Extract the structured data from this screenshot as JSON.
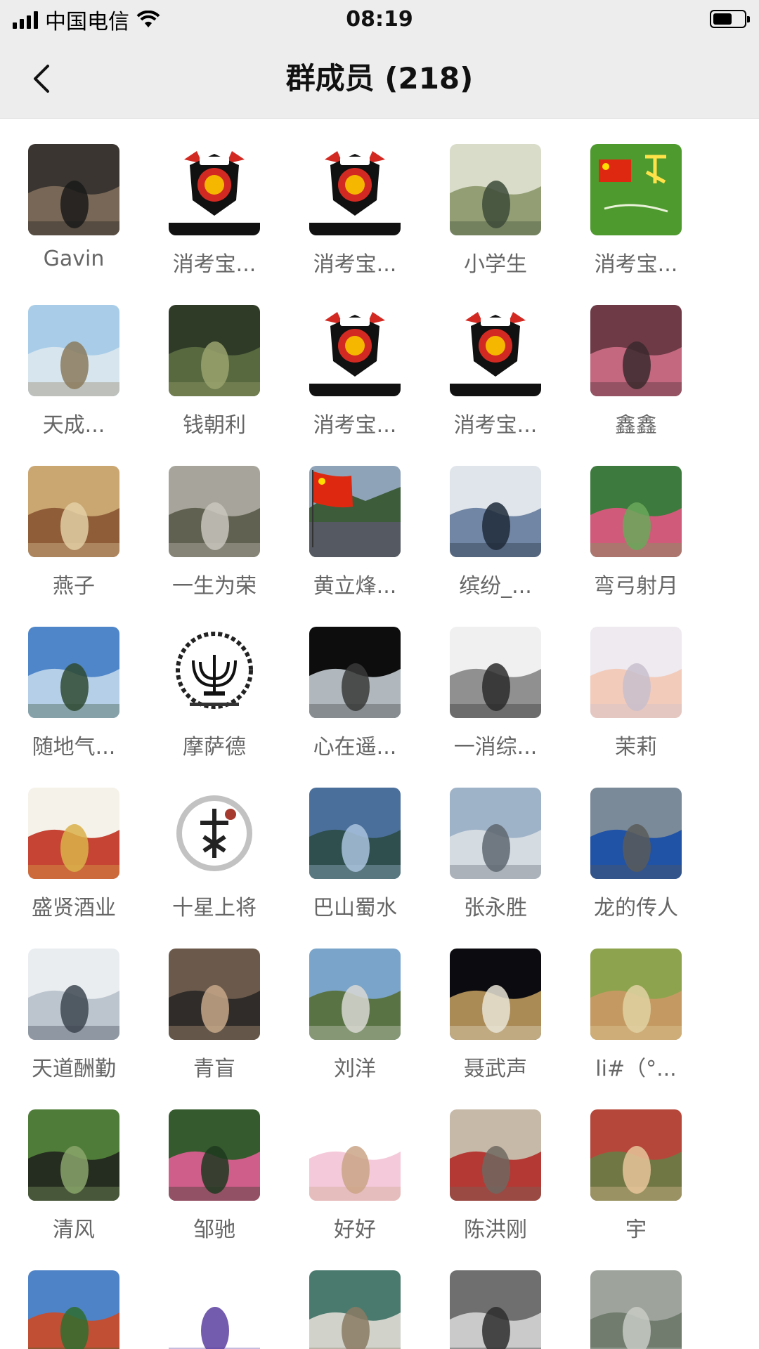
{
  "status_bar": {
    "carrier": "中国电信",
    "time": "08:19"
  },
  "nav": {
    "title": "群成员 (218)"
  },
  "members": [
    {
      "name": "Gavin",
      "avatar": {
        "type": "photo",
        "colors": [
          "#3a3530",
          "#7b6a58",
          "#1a1a1a"
        ]
      }
    },
    {
      "name": "消考宝...",
      "avatar": {
        "type": "xkb-logo"
      }
    },
    {
      "name": "消考宝...",
      "avatar": {
        "type": "xkb-logo"
      }
    },
    {
      "name": "小学生",
      "avatar": {
        "type": "photo",
        "colors": [
          "#d8dcc8",
          "#8f9a70",
          "#3d4a38"
        ]
      }
    },
    {
      "name": "消考宝...",
      "avatar": {
        "type": "flag-grass"
      }
    },
    {
      "name": "天成...",
      "avatar": {
        "type": "photo",
        "colors": [
          "#a9cde8",
          "#d9e6ee",
          "#8b7a5c"
        ]
      }
    },
    {
      "name": "钱朝利",
      "avatar": {
        "type": "photo",
        "colors": [
          "#2f3b27",
          "#5b6b41",
          "#9aa36e"
        ]
      }
    },
    {
      "name": "消考宝...",
      "avatar": {
        "type": "xkb-logo"
      }
    },
    {
      "name": "消考宝...",
      "avatar": {
        "type": "xkb-logo"
      }
    },
    {
      "name": "鑫鑫",
      "avatar": {
        "type": "photo",
        "colors": [
          "#6d3a45",
          "#c86a83",
          "#3b2a2e"
        ]
      }
    },
    {
      "name": "燕子",
      "avatar": {
        "type": "photo",
        "colors": [
          "#caa671",
          "#8b5a36",
          "#e3cfa4"
        ]
      }
    },
    {
      "name": "一生为荣",
      "avatar": {
        "type": "photo",
        "colors": [
          "#a7a59b",
          "#5d5d4d",
          "#c9c6bd"
        ]
      }
    },
    {
      "name": "黄立烽...",
      "avatar": {
        "type": "photo-flag",
        "colors": [
          "#8fa3b8",
          "#3d5c3a",
          "#555a62"
        ]
      }
    },
    {
      "name": "缤纷_...",
      "avatar": {
        "type": "photo",
        "colors": [
          "#dfe5ea",
          "#6a7fa0",
          "#1f2a3a"
        ]
      }
    },
    {
      "name": "弯弓射月",
      "avatar": {
        "type": "photo",
        "colors": [
          "#3c7a3d",
          "#d8587d",
          "#6aa85a"
        ]
      }
    },
    {
      "name": "随地气...",
      "avatar": {
        "type": "photo",
        "colors": [
          "#4f86c9",
          "#bcd3ea",
          "#2f4a31"
        ]
      }
    },
    {
      "name": "摩萨德",
      "avatar": {
        "type": "emblem"
      }
    },
    {
      "name": "心在遥...",
      "avatar": {
        "type": "photo",
        "colors": [
          "#0d0d0d",
          "#b9c2c8",
          "#3a3a3a"
        ]
      }
    },
    {
      "name": "一消综...",
      "avatar": {
        "type": "photo",
        "colors": [
          "#f0f0f0",
          "#8a8a8a",
          "#2b2b2b"
        ]
      }
    },
    {
      "name": "茉莉",
      "avatar": {
        "type": "photo",
        "colors": [
          "#eeeaf0",
          "#f2c9b7",
          "#c8c0cc"
        ]
      }
    },
    {
      "name": "盛贤酒业",
      "avatar": {
        "type": "photo",
        "colors": [
          "#f5f2ea",
          "#c23a2a",
          "#d9b24a"
        ]
      }
    },
    {
      "name": "十星上将",
      "avatar": {
        "type": "ink-seal"
      }
    },
    {
      "name": "巴山蜀水",
      "avatar": {
        "type": "photo",
        "colors": [
          "#4b6f9b",
          "#2c4d4a",
          "#a9c3de"
        ]
      }
    },
    {
      "name": "张永胜",
      "avatar": {
        "type": "photo",
        "colors": [
          "#9fb3c8",
          "#d7dde3",
          "#5e6670"
        ]
      }
    },
    {
      "name": "龙的传人",
      "avatar": {
        "type": "photo",
        "colors": [
          "#7a8a99",
          "#1b4fa6",
          "#5a5a58"
        ]
      }
    },
    {
      "name": "天道酬勤",
      "avatar": {
        "type": "photo",
        "colors": [
          "#e9edf0",
          "#b9c3cb",
          "#3d4650"
        ]
      }
    },
    {
      "name": "青盲",
      "avatar": {
        "type": "photo",
        "colors": [
          "#6b5a4c",
          "#2d2a27",
          "#c7a889"
        ]
      }
    },
    {
      "name": "刘洋",
      "avatar": {
        "type": "photo",
        "colors": [
          "#7aa4c9",
          "#59713d",
          "#d9d9d4"
        ]
      }
    },
    {
      "name": "聂武声",
      "avatar": {
        "type": "photo",
        "colors": [
          "#0c0c10",
          "#b3915a",
          "#e9e4d6"
        ]
      }
    },
    {
      "name": "li#（°...",
      "avatar": {
        "type": "photo",
        "colors": [
          "#8ea34e",
          "#c79a63",
          "#e1d2a3"
        ]
      }
    },
    {
      "name": "清风",
      "avatar": {
        "type": "photo",
        "colors": [
          "#4f7d39",
          "#23281f",
          "#89a56b"
        ]
      }
    },
    {
      "name": "邹驰",
      "avatar": {
        "type": "photo",
        "colors": [
          "#355a2d",
          "#d95f8f",
          "#1f3a20"
        ]
      }
    },
    {
      "name": "好好",
      "avatar": {
        "type": "photo",
        "colors": [
          "#ffffff",
          "#f3c6d8",
          "#caa586"
        ]
      }
    },
    {
      "name": "陈洪刚",
      "avatar": {
        "type": "photo",
        "colors": [
          "#c7b9a8",
          "#b3322d",
          "#6e6860"
        ]
      }
    },
    {
      "name": "宇",
      "avatar": {
        "type": "photo",
        "colors": [
          "#b5473a",
          "#6e7a45",
          "#e7c69b"
        ]
      }
    },
    {
      "name": "",
      "avatar": {
        "type": "photo",
        "colors": [
          "#4f83c7",
          "#c64c2c",
          "#2f6d2f"
        ]
      }
    },
    {
      "name": "",
      "avatar": {
        "type": "photo",
        "colors": [
          "#ffffff",
          "#ffffff",
          "#5a3ea0"
        ]
      }
    },
    {
      "name": "",
      "avatar": {
        "type": "photo",
        "colors": [
          "#4a7a6e",
          "#d8d8d0",
          "#8b7a64"
        ]
      }
    },
    {
      "name": "",
      "avatar": {
        "type": "photo",
        "colors": [
          "#6f6f6f",
          "#cfcfcf",
          "#2e2e2e"
        ]
      }
    },
    {
      "name": "",
      "avatar": {
        "type": "photo",
        "colors": [
          "#9ea39c",
          "#6f7a6b",
          "#c7cbc4"
        ]
      }
    }
  ]
}
